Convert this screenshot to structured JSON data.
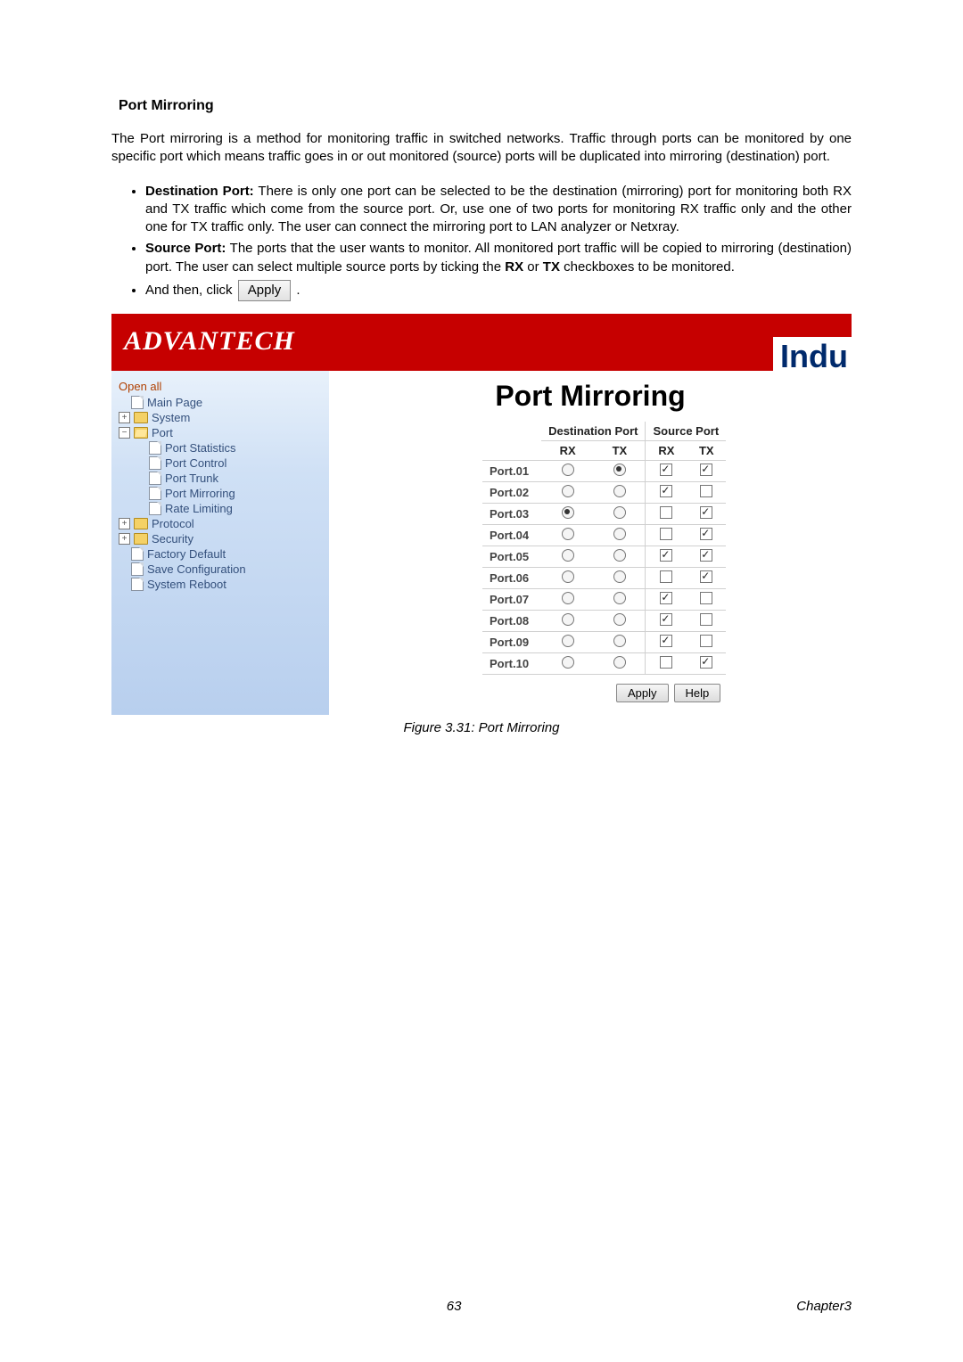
{
  "doc": {
    "heading": "Port Mirroring",
    "paragraph": "The Port mirroring is a method for monitoring traffic in switched networks. Traffic through ports can be monitored by one specific port which means traffic goes in or out monitored (source) ports will be duplicated into mirroring (destination) port.",
    "bullets": {
      "dest_label": "Destination Port:",
      "dest_text": " There is only one port can be selected to be the destination (mirroring) port for monitoring both RX and TX traffic which come from the source port. Or, use one of two ports for monitoring RX traffic only and the other one for TX traffic only. The user can connect the mirroring port to LAN analyzer or Netxray.",
      "src_label": "Source Port:",
      "src_text_a": " The ports that the user wants to monitor. All monitored port traffic will be copied to mirroring (destination) port. The user can select multiple source ports by ticking the ",
      "src_rx": "RX",
      "src_or": " or ",
      "src_tx": "TX",
      "src_text_b": " checkboxes to be monitored.",
      "then_a": "And then, click ",
      "apply_btn": "Apply",
      "then_b": " ."
    },
    "figure_caption": "Figure 3.31: Port Mirroring",
    "page_num": "63",
    "chapter": "Chapter3"
  },
  "ui": {
    "brand": "ADVANTECH",
    "brand_cut": "Indu",
    "open_all": "Open all",
    "tree": {
      "main_page": "Main Page",
      "system": "System",
      "port": "Port",
      "port_children": [
        "Port Statistics",
        "Port Control",
        "Port Trunk",
        "Port Mirroring",
        "Rate Limiting"
      ],
      "protocol": "Protocol",
      "security": "Security",
      "factory_default": "Factory Default",
      "save_config": "Save Configuration",
      "system_reboot": "System Reboot"
    },
    "main_title": "Port Mirroring",
    "table": {
      "dest_header": "Destination Port",
      "src_header": "Source Port",
      "rx": "RX",
      "tx": "TX",
      "rows": [
        {
          "port": "Port.01",
          "drx": false,
          "dtx": true,
          "srx": true,
          "stx": true
        },
        {
          "port": "Port.02",
          "drx": false,
          "dtx": false,
          "srx": true,
          "stx": false
        },
        {
          "port": "Port.03",
          "drx": true,
          "dtx": false,
          "srx": false,
          "stx": true
        },
        {
          "port": "Port.04",
          "drx": false,
          "dtx": false,
          "srx": false,
          "stx": true
        },
        {
          "port": "Port.05",
          "drx": false,
          "dtx": false,
          "srx": true,
          "stx": true
        },
        {
          "port": "Port.06",
          "drx": false,
          "dtx": false,
          "srx": false,
          "stx": true
        },
        {
          "port": "Port.07",
          "drx": false,
          "dtx": false,
          "srx": true,
          "stx": false
        },
        {
          "port": "Port.08",
          "drx": false,
          "dtx": false,
          "srx": true,
          "stx": false
        },
        {
          "port": "Port.09",
          "drx": false,
          "dtx": false,
          "srx": true,
          "stx": false
        },
        {
          "port": "Port.10",
          "drx": false,
          "dtx": false,
          "srx": false,
          "stx": true
        }
      ]
    },
    "buttons": {
      "apply": "Apply",
      "help": "Help"
    }
  }
}
